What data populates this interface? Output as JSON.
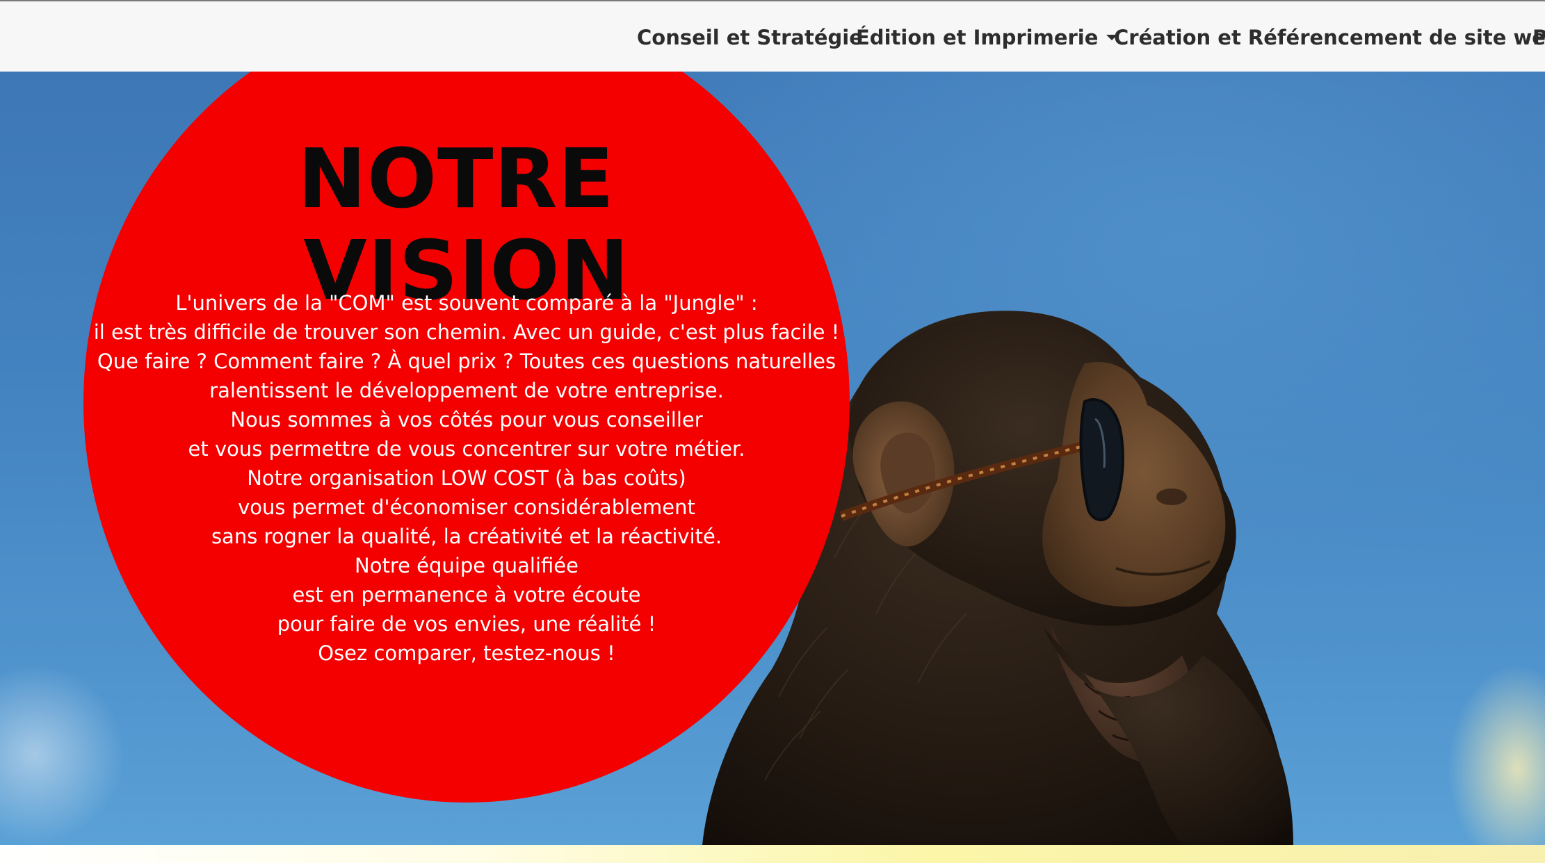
{
  "navbar": {
    "items": [
      {
        "label": "Conseil et Stratégie",
        "has_dropdown": false
      },
      {
        "label": "Édition et Imprimerie",
        "has_dropdown": true
      },
      {
        "label": "Création et Référencement de site web",
        "has_dropdown": true
      },
      {
        "label": "P",
        "has_dropdown": false
      }
    ]
  },
  "hero": {
    "title_line1": "NOTRE",
    "title_line2": "VISION",
    "paragraph_lines": [
      "L'univers de la \"COM\" est souvent comparé à la \"Jungle\" :",
      "il est très difficile de trouver son chemin. Avec un guide, c'est plus facile !",
      "Que faire ? Comment faire ? À quel prix ? Toutes ces questions naturelles",
      "ralentissent le développement de votre entreprise.",
      "Nous sommes à vos côtés pour vous conseiller",
      "et vous permettre de vous concentrer sur votre métier.",
      "Notre organisation LOW COST (à bas coûts)",
      "vous permet d'économiser considérablement",
      "sans rogner la qualité, la créativité et la réactivité.",
      "Notre équipe qualifiée",
      "est en permanence à votre écoute",
      "pour faire de vos envies, une réalité !",
      "Osez comparer, testez-nous !"
    ],
    "colors": {
      "circle": "#f40000",
      "sky": "#4383c0",
      "title": "#0a0a0a",
      "text": "#ffffff"
    },
    "image_icon": "chimpanzee-with-sunglasses-image"
  }
}
